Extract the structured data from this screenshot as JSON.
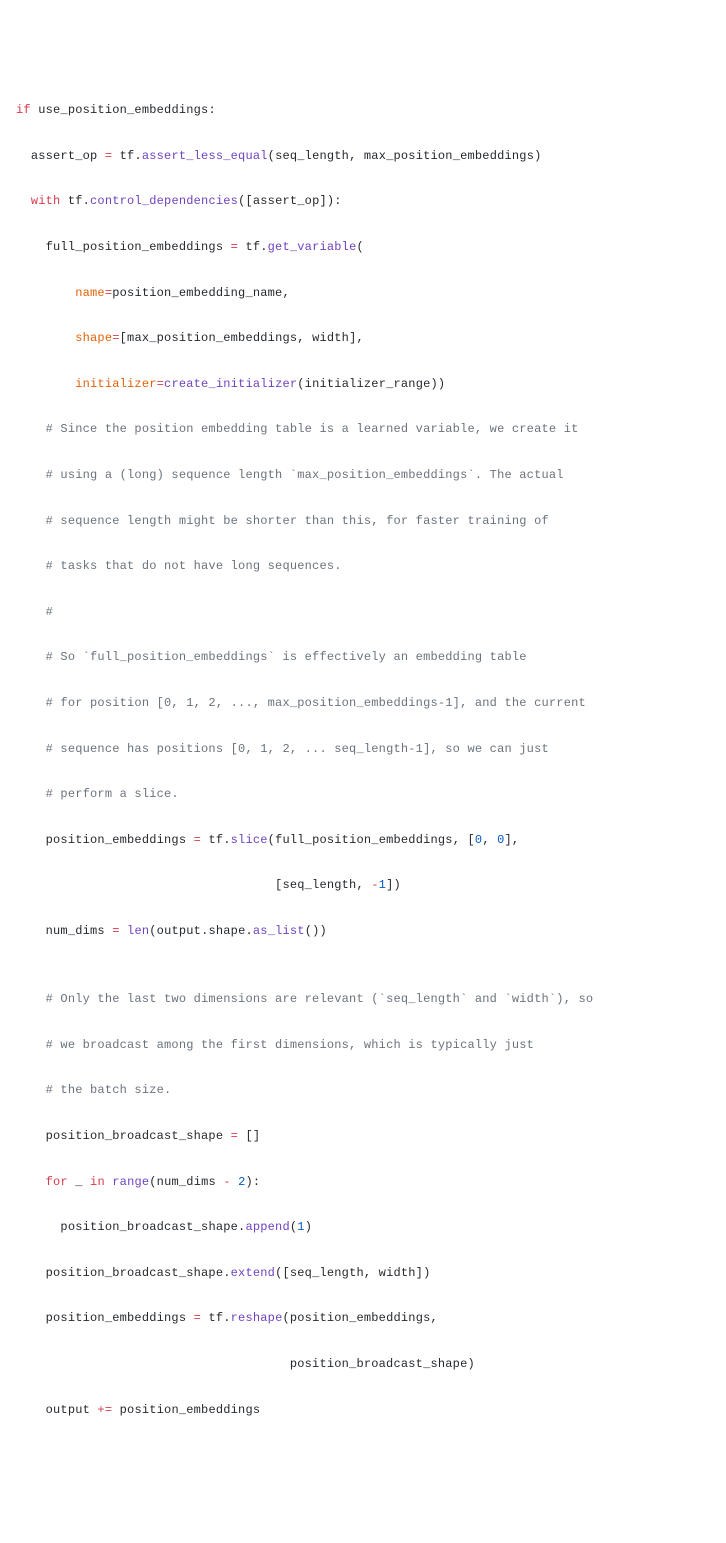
{
  "code": {
    "l01": {
      "kw_if": "if",
      "var": "use_position_embeddings",
      "colon": ":"
    },
    "l02": {
      "a": "assert_op ",
      "op": "=",
      "b": " tf.",
      "fn": "assert_less_equal",
      "args": "(seq_length, max_position_embeddings)"
    },
    "l03": {
      "kw_with": "with",
      "a": " tf.",
      "fn": "control_dependencies",
      "args": "([assert_op])",
      "colon": ":"
    },
    "l04": {
      "a": "full_position_embeddings ",
      "op": "=",
      "b": " tf.",
      "fn": "get_variable",
      "p": "("
    },
    "l05": {
      "arg": "name",
      "op": "=",
      "val": "position_embedding_name,"
    },
    "l06": {
      "arg": "shape",
      "op": "=",
      "val": "[max_position_embeddings, width],"
    },
    "l07": {
      "arg": "initializer",
      "op": "=",
      "fn": "create_initializer",
      "val": "(initializer_range))"
    },
    "l08": {
      "c": "# Since the position embedding table is a learned variable, we create it"
    },
    "l09": {
      "c": "# using a (long) sequence length `max_position_embeddings`. The actual"
    },
    "l10": {
      "c": "# sequence length might be shorter than this, for faster training of"
    },
    "l11": {
      "c": "# tasks that do not have long sequences."
    },
    "l12": {
      "c": "#"
    },
    "l13": {
      "c": "# So `full_position_embeddings` is effectively an embedding table"
    },
    "l14": {
      "c": "# for position [0, 1, 2, ..., max_position_embeddings-1], and the current"
    },
    "l15": {
      "c": "# sequence has positions [0, 1, 2, ... seq_length-1], so we can just"
    },
    "l16": {
      "c": "# perform a slice."
    },
    "l17": {
      "a": "position_embeddings ",
      "op": "=",
      "b": " tf.",
      "fn": "slice",
      "p1": "(full_position_embeddings, [",
      "n0": "0",
      "comma": ", ",
      "n1": "0",
      "p2": "],"
    },
    "l18": {
      "p1": "[seq_length, ",
      "op": "-",
      "n": "1",
      "p2": "])"
    },
    "l19": {
      "a": "num_dims ",
      "op": "=",
      "sp": " ",
      "fn1": "len",
      "p1": "(output.shape.",
      "fn2": "as_list",
      "p2": "())"
    },
    "l20": {
      "blank": ""
    },
    "l21": {
      "c": "# Only the last two dimensions are relevant (`seq_length` and `width`), so"
    },
    "l22": {
      "c": "# we broadcast among the first dimensions, which is typically just"
    },
    "l23": {
      "c": "# the batch size."
    },
    "l24": {
      "a": "position_broadcast_shape ",
      "op": "=",
      "b": " []"
    },
    "l25": {
      "kw_for": "for",
      "under": " _ ",
      "kw_in": "in",
      "sp": " ",
      "fn": "range",
      "p1": "(num_dims ",
      "op": "-",
      "sp2": " ",
      "n": "2",
      "p2": "):"
    },
    "l26": {
      "a": "position_broadcast_shape.",
      "fn": "append",
      "p1": "(",
      "n": "1",
      "p2": ")"
    },
    "l27": {
      "a": "position_broadcast_shape.",
      "fn": "extend",
      "p": "([seq_length, width])"
    },
    "l28": {
      "a": "position_embeddings ",
      "op": "=",
      "b": " tf.",
      "fn": "reshape",
      "p": "(position_embeddings,"
    },
    "l29": {
      "a": "position_broadcast_shape)"
    },
    "l30": {
      "a": "output ",
      "op": "+=",
      "b": " position_embeddings"
    }
  }
}
